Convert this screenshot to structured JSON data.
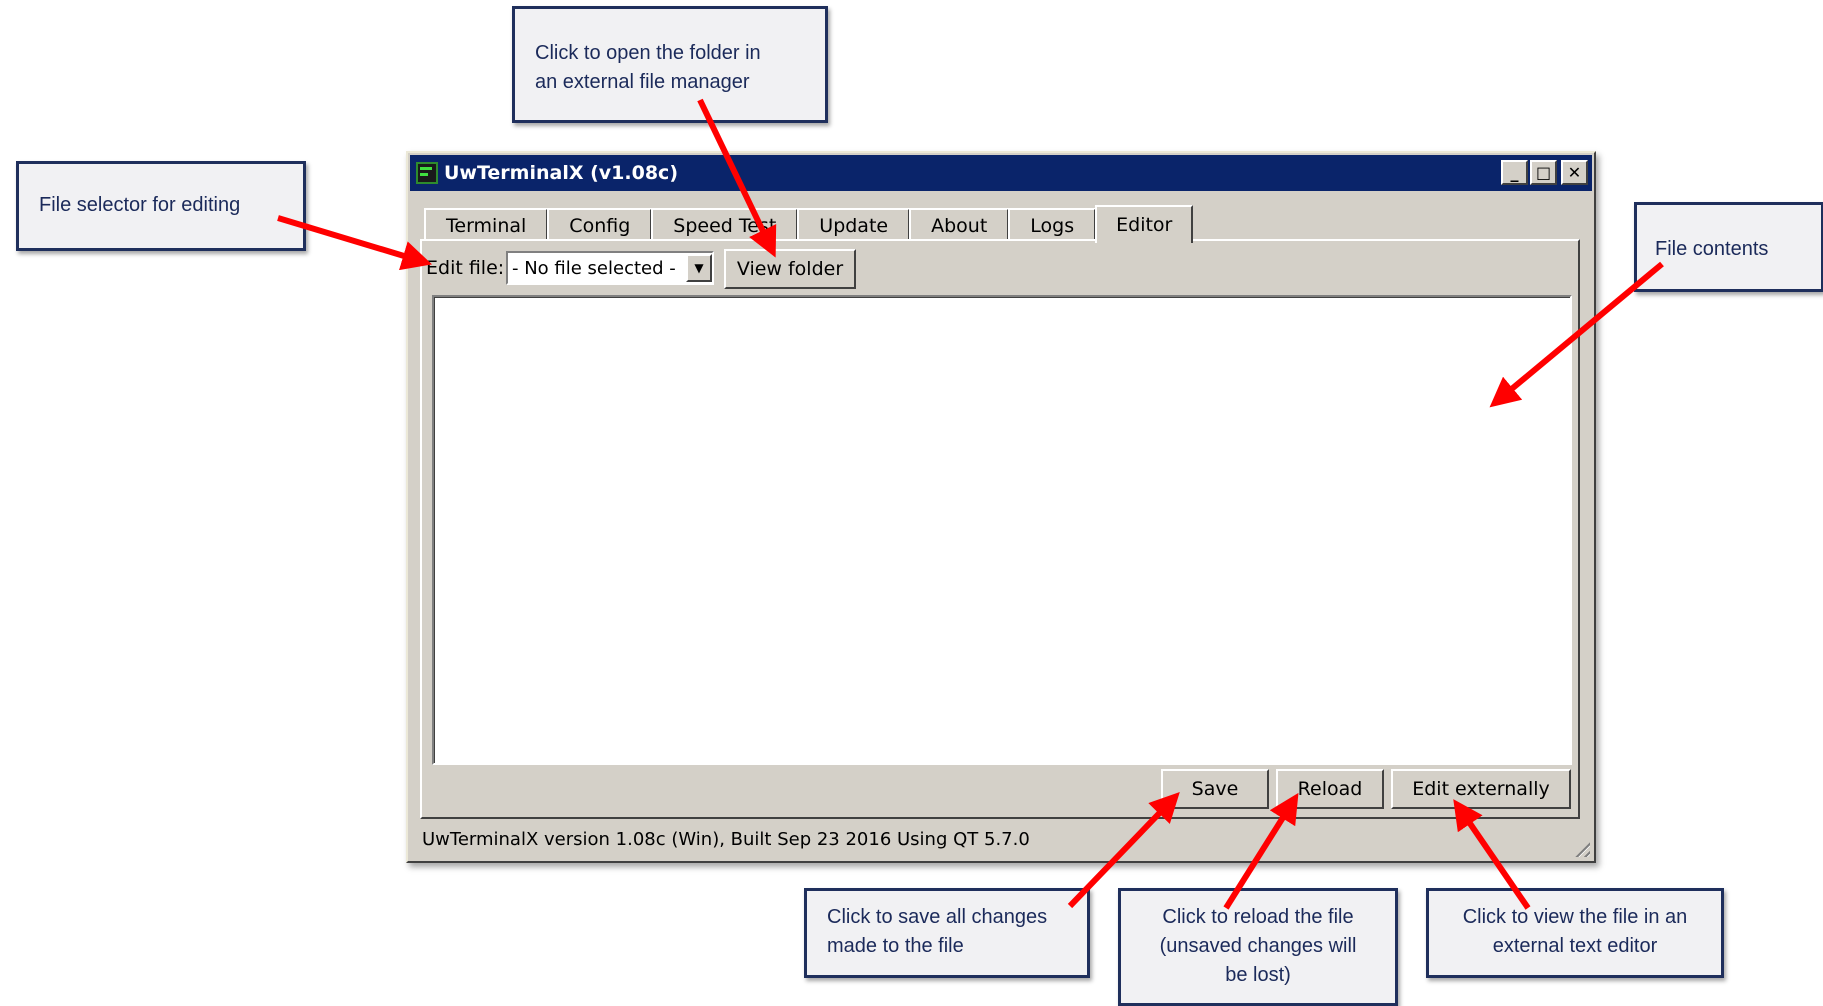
{
  "window": {
    "title": "UwTerminalX (v1.08c)",
    "controls": {
      "minimize": "_",
      "maximize": "□",
      "close": "✕"
    }
  },
  "tabs": [
    {
      "label": "Terminal"
    },
    {
      "label": "Config"
    },
    {
      "label": "Speed Test"
    },
    {
      "label": "Update"
    },
    {
      "label": "About"
    },
    {
      "label": "Logs"
    },
    {
      "label": "Editor",
      "active": true
    }
  ],
  "editor": {
    "edit_file_label": "Edit file:",
    "file_select_value": "- No file selected -",
    "dropdown_icon": "▼",
    "view_folder_label": "View folder",
    "save_label": "Save",
    "reload_label": "Reload",
    "edit_externally_label": "Edit externally",
    "content": ""
  },
  "status_bar": {
    "text": "UwTerminalX version 1.08c (Win), Built Sep 23 2016 Using QT 5.7.0"
  },
  "callouts": {
    "file_selector": "File selector for editing",
    "view_folder_line1": "Click to open the folder in",
    "view_folder_line2": "an external file manager",
    "file_contents": "File contents",
    "save_line1": "Click to save all changes",
    "save_line2": "made to the file",
    "reload_line1": "Click to reload the file",
    "reload_line2": "(unsaved changes will",
    "reload_line3": "be lost)",
    "edit_ext_line1": "Click to view the file in an",
    "edit_ext_line2": "external text editor"
  },
  "colors": {
    "window_face": "#d4d0c8",
    "titlebar": "#0a246a",
    "callout_border": "#1f2f5c",
    "callout_bg": "#f1f1f3",
    "arrow": "#ff0000"
  }
}
